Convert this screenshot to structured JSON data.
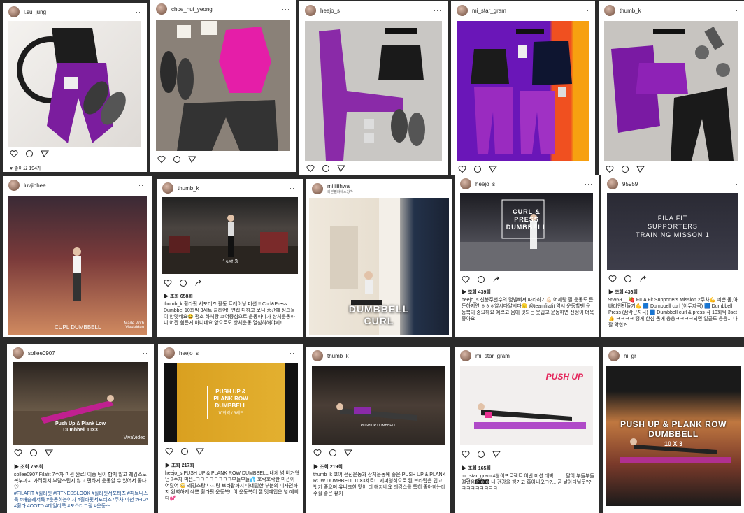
{
  "row1": [
    {
      "user": "l.su_jung",
      "likes": "♥ 좋아요 194개"
    },
    {
      "user": "choe_hui_yeong",
      "likes": ""
    },
    {
      "user": "heejo_s",
      "likes": ""
    },
    {
      "user": "mi_star_gram",
      "likes": ""
    },
    {
      "user": "thumb_k",
      "likes": ""
    }
  ],
  "row2": [
    {
      "user": "luvjinhee",
      "overlay": "CUPL DUMBBELL",
      "watermark": "Made With VivaVideo",
      "views": "",
      "caption": ""
    },
    {
      "user": "thumb_k",
      "overlay": "1set 3",
      "views": "▶ 조회 658회",
      "caption": "thumb_k 휠라핏 서포터즈 활동 트레이닝 미션 !! Curl&Press Dumbbel 10회씩 3세트 클리어!! 편집 다하고 보니 중간에 싱크들이 안맞네요😂 평소 하체랑 코어중심으로 운동하다가 상체운동하니 어깐 힘든게 아니네요 앞으로도 상체운동 열심히해야지!!"
    },
    {
      "user": "miiiiiihwa_",
      "sublabel": "리본필라테스강박",
      "overlay": "DUMBBELL CURL",
      "views": "",
      "caption": ""
    },
    {
      "user": "heejo_s",
      "overlay": "CURL & PRESS DUMBBELL",
      "views": "▶ 조회 439회",
      "caption": "heejo_s 신봉주선수의 덤벨뻐져 따라하기💪🏻 어깨랑 팔 운동도 든든하지연 ㅎㅎㅎ알시다알시다🙂 @teamfilafit 역시 운동할땐 운동복이 중요해요 예쁘고 몸에 핏되는 옷입고 운동하면 진정이 더욱 좋아요"
    },
    {
      "user": "95959__",
      "overlay": "FILA FIT SUPPORTERS TRAINING MISSON 1",
      "views": "▶ 조회 436회",
      "caption": "95959__ 🍓 FILA Fit Supporters Mission 2주차💪 예쁜 몸,아빠라인만들기💪 🟦 Dumbbell curl (이두자극) 🟦 Dumbbell Press (삼각근자극) 🟦 Dumbbell curl & press 각 10회씩 3set 👍 ㅋㅋㅋㅋ 땡게 한심 몸에 응응ㅋㅋㅋㅋ되면 일골도 응응... 나 팔 약한거"
    }
  ],
  "row3": [
    {
      "user": "sollee0907",
      "overlay": "Push Up & Plank Low Dumbbell 10×3",
      "watermark": "VivaVideo",
      "views": "▶ 조회 755회",
      "caption": "sollee0907 Filafit 7주차 미션 완료! 이중 팀이 함지 않고 레깅스도 복부까지 가려줘서 부담스럽지 않고 편하게 운동할 수 있어서 좋다♡",
      "tags": "#FILAFIT #휠라핏 #FITNESSLOOK #휠라핏서포터즈 #피트니스룩 #애슬레저룩 #운동하는여자 #휠라핏서포터즈7주차 미션 #FILA #휠라 #OOTD #데일리룩 #포스터그램 #운동스"
    },
    {
      "user": "heejo_s",
      "overlay": "PUSH UP & PLANK ROW DUMBBELL",
      "subov": "10회씩 / 3세트",
      "views": "▶ 조회 217회",
      "caption": "heejo_s PUSH UP & PLANK ROW DUMBBELL 내게 넘 버거웠던 7주차 미션..ㅋㅋㅋㅋㅋㅋㅋㅋ부들부들💦 호락호락한 미션이 어딨어 😳 레깅스랑 나시랑 브라탑까지 다데일한 부분의 디자인까지 완벽하게 예쁜 휠라핏 운동복!! 이 운동복이 젤 멋예입은 넘 예뻐다💕"
    },
    {
      "user": "thumb_k",
      "overlay": "PUSH UP DUMBBELL",
      "views": "▶ 조회 219회",
      "caption": "thumb_k 코어 전신운동과 상체운동에 좋은 PUSH UP & PLANK ROW DUMBBELL 10×3세트! . 지퍼형식으로 된 브라탑은 입고 벗기 좋으며 유니크한 맛이 더 해지네요 레깅스를 특히 좋아하는데 수휠 좋은 유키"
    },
    {
      "user": "mi_star_gram",
      "overlay": "PUSH UP",
      "views": "▶ 조회 165회",
      "caption": "mi_star_gram #쌍이프로젝트 이번 미션 대박........ 팔이 부들부들 떨렸음🅿🅾🅾 내 건강을 챙기고 흑아니오ㅋ?... 곧 날아다닐듯?? ㅋㅋㅋㅋㅋㅋㅋㅋ"
    },
    {
      "user": "hi_gr",
      "overlay": "PUSH UP & PLANK ROW DUMBBELL",
      "subov": "10 X 3",
      "views": "",
      "caption": ""
    }
  ],
  "colors": {
    "purple": "#7a1fa0",
    "pink": "#e41b8e"
  }
}
